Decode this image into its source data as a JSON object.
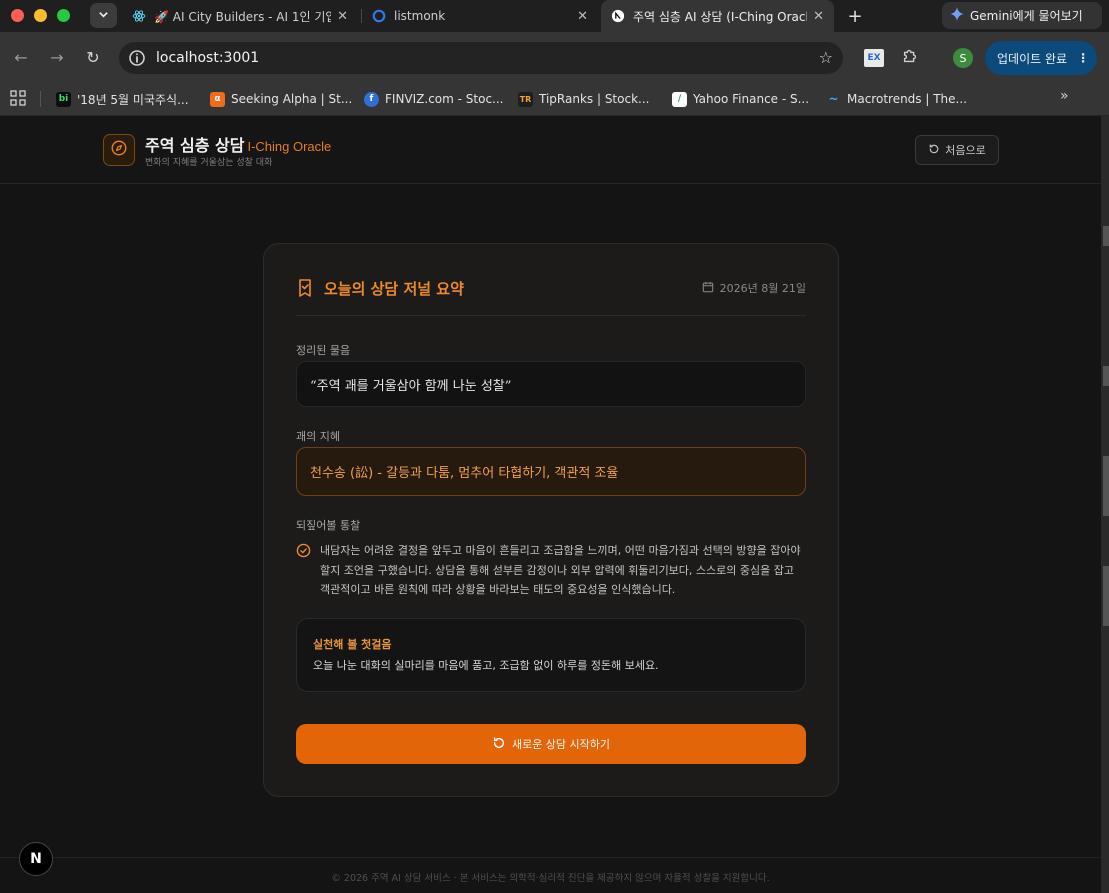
{
  "browser": {
    "tabs": [
      {
        "title": "🚀 AI City Builders - AI 1인 기업",
        "icon": "react-icon"
      },
      {
        "title": "listmonk",
        "icon": "listmonk-icon"
      },
      {
        "title": "주역 심층 AI 상담 (I-Ching Oracle)",
        "icon": "nextjs-icon",
        "active": true
      }
    ],
    "gemini_label": "Gemini에게 물어보기",
    "url": "localhost:3001",
    "update_label": "업데이트 완료",
    "profile_initial": "S",
    "extension_label": "EX",
    "bookmarks": [
      {
        "label": "'18년 5월 미국주식...",
        "icon_text": "bi",
        "color": "#0d0d0d",
        "fg": "#3ddc6a"
      },
      {
        "label": "Seeking Alpha | St...",
        "icon_text": "α",
        "color": "#f26b1d",
        "fg": "#ffffff"
      },
      {
        "label": "FINVIZ.com - Stoc...",
        "icon_text": "f",
        "color": "#2f6fd6",
        "fg": "#ffffff"
      },
      {
        "label": "TipRanks | Stock...",
        "icon_text": "TR",
        "color": "#1e1e1e",
        "fg": "#f0a23a"
      },
      {
        "label": "Yahoo Finance - S...",
        "icon_text": "/",
        "color": "#ffffff",
        "fg": "#2aa84a"
      },
      {
        "label": "Macrotrends | The...",
        "icon_text": "~",
        "color": "#353535",
        "fg": "#4aa3ff"
      }
    ]
  },
  "app": {
    "title": "주역 심층 상담",
    "title_en": "I-Ching Oracle",
    "tagline": "변화의 지혜를 거울삼는 성찰 대화",
    "reset_label": "처음으로"
  },
  "summary": {
    "title": "오늘의 상담 저널 요약",
    "date": "2026년 8월 21일",
    "question_label": "정리된 물음",
    "question": "“주역 괘를 거울삼아 함께 나눈 성찰”",
    "wisdom_label": "괘의 지혜",
    "wisdom": "천수송 (訟) - 갈등과 다툼, 멈추어 타협하기, 객관적 조율",
    "insight_label": "되짚어볼 통찰",
    "insight": "내담자는 어려운 결정을 앞두고 마음이 흔들리고 조급함을 느끼며, 어떤 마음가짐과 선택의 방향을 잡아야 할지 조언을 구했습니다. 상담을 통해 섣부른 감정이나 외부 압력에 휘둘리기보다, 스스로의 중심을 잡고 객관적이고 바른 원칙에 따라 상황을 바라보는 태도의 중요성을 인식했습니다.",
    "action_title": "실천해 볼 첫걸음",
    "action_text": "오늘 나눈 대화의 실마리를 마음에 품고, 조급함 없이 하루를 정돈해 보세요.",
    "cta_label": "새로운 상담 시작하기"
  },
  "footer": "© 2026 주역 AI 상담 서비스 · 본 서비스는 의학적·심리적 진단을 제공하지 않으며 자율적 성찰을 지원합니다.",
  "dev_badge": "N",
  "colors": {
    "accent": "#e2650a",
    "accent_text": "#ec8a2c",
    "background": "#141414",
    "card": "#1c1b1a"
  }
}
